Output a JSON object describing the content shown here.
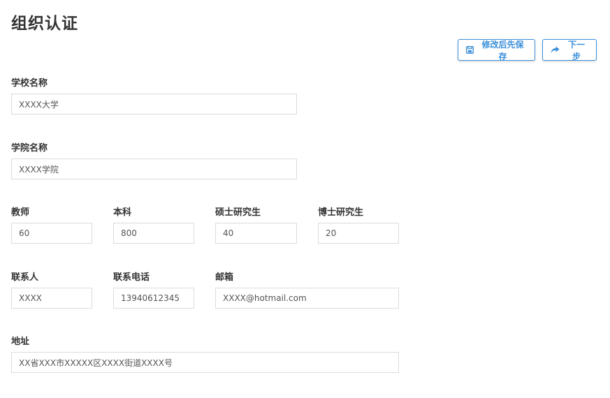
{
  "page": {
    "title": "组织认证"
  },
  "toolbar": {
    "save_label": "修改后先保存",
    "save_icon": "save-icon",
    "next_label": "下一步",
    "next_icon": "share-forward-icon",
    "accent_color": "#3a8fd9"
  },
  "form": {
    "school_name": {
      "label": "学校名称",
      "value": "XXXX大学"
    },
    "college_name": {
      "label": "学院名称",
      "value": "XXXX学院"
    },
    "teachers": {
      "label": "教师",
      "value": "60"
    },
    "undergrad": {
      "label": "本科",
      "value": "800"
    },
    "masters": {
      "label": "硕士研究生",
      "value": "40"
    },
    "phd": {
      "label": "博士研究生",
      "value": "20"
    },
    "contact_person": {
      "label": "联系人",
      "value": "XXXX"
    },
    "contact_phone": {
      "label": "联系电话",
      "value": "13940612345"
    },
    "email": {
      "label": "邮箱",
      "value": "XXXX@hotmail.com"
    },
    "address": {
      "label": "地址",
      "value": "XX省XXX市XXXXX区XXXX街道XXXX号"
    }
  }
}
